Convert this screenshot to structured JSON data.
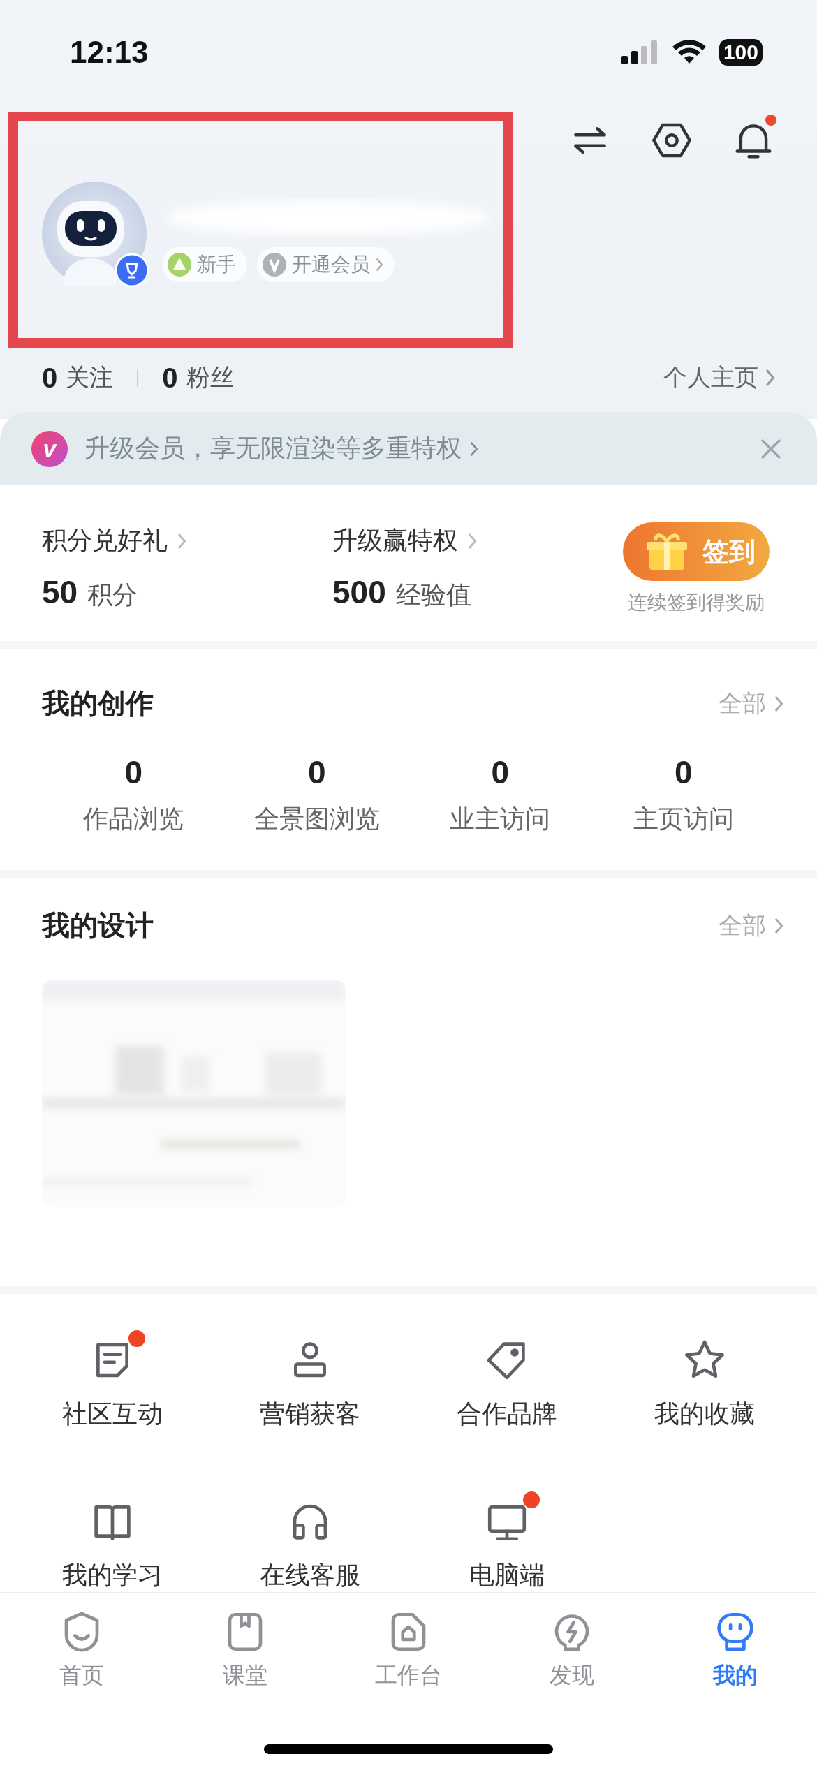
{
  "status_bar": {
    "time": "12:13",
    "battery": "100"
  },
  "header_actions": [
    {
      "unread": false
    },
    {
      "unread": false
    },
    {
      "unread": true
    }
  ],
  "profile": {
    "badges": [
      {
        "kind": "level",
        "label": "新手",
        "chevron": false
      },
      {
        "kind": "vip",
        "label": "开通会员",
        "chevron": true
      }
    ],
    "follow": [
      {
        "count": "0",
        "label": "关注"
      },
      {
        "count": "0",
        "label": "粉丝"
      }
    ],
    "homepage_link": "个人主页"
  },
  "annotation": {
    "kind": "frame"
  },
  "vip_banner": {
    "logo": "v",
    "text": "升级会员，享无限渲染等多重特权"
  },
  "points": [
    {
      "title": "积分兑好礼",
      "value": "50",
      "unit": "积分"
    },
    {
      "title": "升级赢特权",
      "value": "500",
      "unit": "经验值"
    }
  ],
  "checkin": {
    "label": "签到",
    "caption": "连续签到得奖励"
  },
  "creations": {
    "title": "我的创作",
    "more": "全部",
    "stats": [
      {
        "value": "0",
        "label": "作品浏览"
      },
      {
        "value": "0",
        "label": "全景图浏览"
      },
      {
        "value": "0",
        "label": "业主访问"
      },
      {
        "value": "0",
        "label": "主页访问"
      }
    ]
  },
  "designs": {
    "title": "我的设计",
    "more": "全部"
  },
  "tools": [
    {
      "label": "社区互动",
      "unread": true
    },
    {
      "label": "营销获客",
      "unread": false
    },
    {
      "label": "合作品牌",
      "unread": false
    },
    {
      "label": "我的收藏",
      "unread": false
    },
    {
      "label": "我的学习",
      "unread": false
    },
    {
      "label": "在线客服",
      "unread": false
    },
    {
      "label": "电脑端",
      "unread": true
    }
  ],
  "tab_bar": [
    {
      "label": "首页",
      "selected": false
    },
    {
      "label": "课堂",
      "selected": false
    },
    {
      "label": "工作台",
      "selected": false
    },
    {
      "label": "发现",
      "selected": false
    },
    {
      "label": "我的",
      "selected": true
    }
  ]
}
